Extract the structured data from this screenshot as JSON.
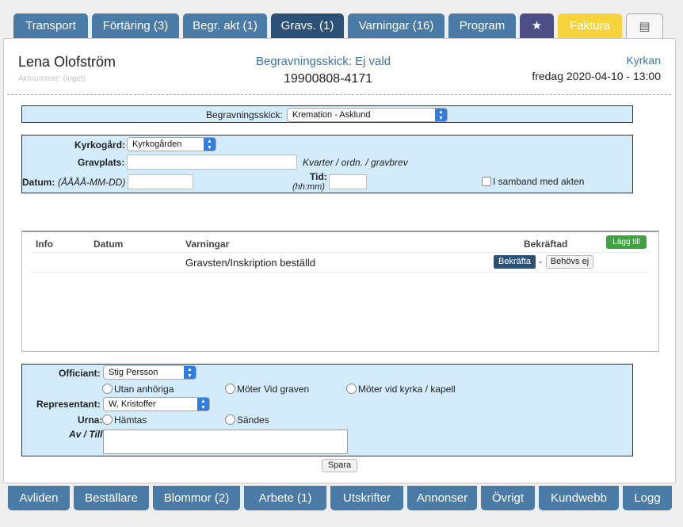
{
  "top_tabs": [
    {
      "label": "Transport"
    },
    {
      "label": "Förtäring (3)"
    },
    {
      "label": "Begr. akt (1)"
    },
    {
      "label": "Gravs. (1)"
    },
    {
      "label": "Varningar (16)"
    },
    {
      "label": "Program"
    },
    {
      "label": "★",
      "icon": "star-icon"
    },
    {
      "label": "Faktura"
    },
    {
      "label": "▤",
      "icon": "document-icon"
    }
  ],
  "header": {
    "name": "Lena Olofström",
    "aktnummer": "Aktnummer: (inget)",
    "begravningsskick_title": "Begravningsskick: Ej vald",
    "personnummer": "19900808-4171",
    "location": "Kyrkan",
    "datetime": "fredag 2020-04-10 - 13:00"
  },
  "begravningsskick": {
    "label": "Begravningsskick:",
    "selected": "Kremation - Asklund"
  },
  "grave": {
    "kyrkogard_label": "Kyrkogård:",
    "kyrkogard_selected": "Kyrkogården",
    "gravplats_label": "Gravplats:",
    "gravplats_value": "",
    "gravplats_hint": "Kvarter / ordn. / gravbrev",
    "datum_label": "Datum:",
    "datum_hint": "(ÅÅÅÅ-MM-DD)",
    "datum_value": "",
    "tid_label": "Tid:",
    "tid_hint": "(hh:mm)",
    "tid_value": "",
    "samband_label": "I samband med akten"
  },
  "warnings": {
    "columns": {
      "info": "Info",
      "datum": "Datum",
      "varningar": "Varningar",
      "bekraftad": "Bekräftad"
    },
    "add_label": "Lägg till",
    "rows": [
      {
        "info": "",
        "datum": "",
        "text": "Gravsten/Inskription beställd",
        "confirm_label": "Bekräfta",
        "separator": "-",
        "not_needed_label": "Behövs ej"
      }
    ]
  },
  "officiant": {
    "officiant_label": "Officiant:",
    "officiant_selected": "Stig Persson",
    "options": [
      "Utan anhöriga",
      "Möter Vid graven",
      "Möter vid kyrka / kapell"
    ],
    "representant_label": "Representant:",
    "representant_selected": "W, Kristoffer",
    "urna_label": "Urna:",
    "urna_options": [
      "Hämtas",
      "Sändes"
    ],
    "av_till_label": "Av / Till",
    "av_till_value": ""
  },
  "save_label": "Spara",
  "bottom_tabs": [
    {
      "label": "Avliden"
    },
    {
      "label": "Beställare"
    },
    {
      "label": "Blommor (2)"
    },
    {
      "label": "Arbete (1)"
    },
    {
      "label": "Utskrifter"
    },
    {
      "label": "Annonser"
    },
    {
      "label": "Övrigt"
    },
    {
      "label": "Kundwebb"
    },
    {
      "label": "Logg"
    }
  ],
  "colors": {
    "tab": "#4a7aa6",
    "tab_active": "#2c5176",
    "tab_star": "#4b4f86",
    "tab_faktura": "#f7d43c",
    "box_fill": "#d3ecfb",
    "link_blue": "#3b73a8",
    "button_green": "#3ea23e"
  }
}
